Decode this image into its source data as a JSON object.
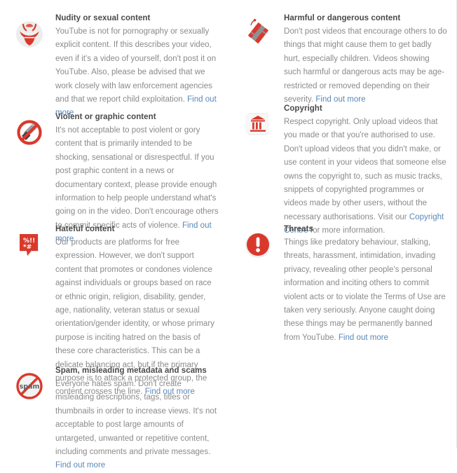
{
  "page": {
    "background": "#ffffff",
    "heading_color": "#4a4a4a",
    "body_color": "#8a8a8a",
    "link_color": "#5b87b8",
    "accent_color": "#d9392c"
  },
  "guidelines": [
    {
      "id": "nudity",
      "icon": "bikini-icon",
      "title": "Nudity or sexual content",
      "body": "YouTube is not for pornography or sexually explicit content. If this describes your video, even if it's a video of yourself, don't post it on YouTube. Also, please be advised that we work closely with law enforcement agencies and that we report child exploitation. ",
      "link": "Find out more",
      "body_tail": ""
    },
    {
      "id": "harmful",
      "icon": "dynamite-icon",
      "title": "Harmful or dangerous content",
      "body": "Don't post videos that encourage others to do things that might cause them to get badly hurt, especially children. Videos showing such harmful or dangerous acts may be age-restricted or removed depending on their severity. ",
      "link": "Find out more",
      "body_tail": ""
    },
    {
      "id": "violent",
      "icon": "no-knife-icon",
      "title": "Violent or graphic content",
      "body": "It's not acceptable to post violent or gory content that is primarily intended to be shocking, sensational or disrespectful. If you post graphic content in a news or documentary context, please provide enough information to help people understand what's going on in the video. Don't encourage others to commit specific acts of violence. ",
      "link": "Find out more",
      "body_tail": ""
    },
    {
      "id": "copyright",
      "icon": "courthouse-scroll-icon",
      "title": "Copyright",
      "body": "Respect copyright. Only upload videos that you made or that you're authorised to use. Don't upload videos that you didn't make, or use content in your videos that someone else owns the copyright to, such as music tracks, snippets of copyrighted programmes or videos made by other users, without the necessary authorisations. Visit our ",
      "link": "Copyright Centre",
      "body_tail": " for more information."
    },
    {
      "id": "hateful",
      "icon": "speech-bubble-censored-icon",
      "title": "Hateful content",
      "body": "Our products are platforms for free expression. However, we don't support content that promotes or condones violence against individuals or groups based on race or ethnic origin, religion, disability, gender, age, nationality, veteran status or sexual orientation/gender identity, or whose primary purpose is inciting hatred on the basis of these core characteristics. This can be a delicate balancing act, but if the primary purpose is to attack a protected group, the content crosses the line. ",
      "link": "Find out more",
      "body_tail": ""
    },
    {
      "id": "threats",
      "icon": "exclamation-circle-icon",
      "title": "Threats",
      "body": "Things like predatory behaviour, stalking, threats, harassment, intimidation, invading privacy, revealing other people's personal information and inciting others to commit violent acts or to violate the Terms of Use are taken very seriously. Anyone caught doing these things may be permanently banned from YouTube. ",
      "link": "Find out more",
      "body_tail": ""
    },
    {
      "id": "spam",
      "icon": "no-spam-icon",
      "title": "Spam, misleading metadata and scams",
      "body": "Everyone hates spam. Don't create misleading descriptions, tags, titles or thumbnails in order to increase views. It's not acceptable to post large amounts of untargeted, unwanted or repetitive content, including comments and private messages. ",
      "link": "Find out more",
      "body_tail": ""
    }
  ],
  "icon_labels": {
    "spam_text": "spam",
    "hateful_symbols": "%!!*#"
  }
}
